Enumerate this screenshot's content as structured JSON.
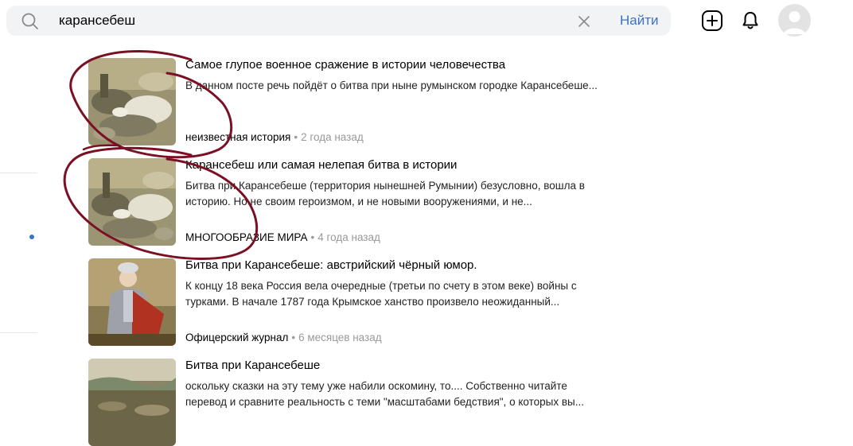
{
  "search": {
    "query": "карансебеш",
    "find_label": "Найти"
  },
  "icons": {
    "search": "search-icon",
    "clear": "close-icon",
    "add": "add-icon",
    "bell": "bell-icon",
    "avatar": "avatar"
  },
  "colors": {
    "accent": "#3a73c6",
    "annotation": "#7a1024",
    "search_bg": "#f2f3f5",
    "meta": "#999999"
  },
  "results": [
    {
      "title": "Самое глупое военное сражение в истории человечества",
      "snippet": "В данном посте речь пойдёт о битва при ныне румынском городке Карансебеше...",
      "source": "неизвестная история",
      "time": "2 года назад"
    },
    {
      "title": "Карансебеш или самая нелепая битва в истории",
      "snippet": "Битва при Карансебеше (территория нынешней Румынии) безусловно, вошла в историю. Но не своим героизмом, и не новыми вооружениями, и не...",
      "source": "МНОГООБРАЗИЕ МИРА",
      "time": "4 года назад"
    },
    {
      "title": "Битва при Карансебеше: австрийский чёрный юмор.",
      "snippet": "К концу 18 века Россия вела очередные (третьи по счету в этом веке) войны с турками. В начале 1787 года Крымское ханство произвело неожиданный...",
      "source": "Офицерский журнал",
      "time": "6 месяцев назад"
    },
    {
      "title": "Битва при Карансебеше",
      "snippet": "оскольку сказки на эту тему уже набили оскомину, то.... Собственно читайте перевод и сравните реальность с теми \"масштабами бедствия\", о которых вы..."
    }
  ]
}
